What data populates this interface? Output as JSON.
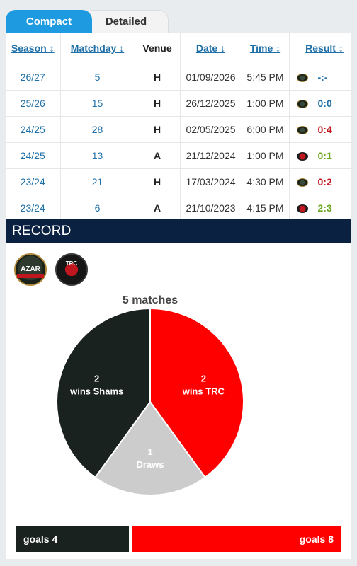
{
  "tabs": {
    "compact": "Compact",
    "detailed": "Detailed"
  },
  "table": {
    "headers": {
      "season": "Season ↕",
      "matchday": "Matchday ↕",
      "venue": "Venue",
      "date": "Date ↓",
      "time": "Time ↕",
      "result": "Result ↕"
    },
    "rows": [
      {
        "season": "26/27",
        "matchday": "5",
        "venue": "H",
        "date": "01/09/2026",
        "time": "5:45 PM",
        "result": "-:-",
        "result_color": "#1e6fa8",
        "logo": "shams"
      },
      {
        "season": "25/26",
        "matchday": "15",
        "venue": "H",
        "date": "26/12/2025",
        "time": "1:00 PM",
        "result": "0:0",
        "result_color": "#1e6fa8",
        "logo": "shams"
      },
      {
        "season": "24/25",
        "matchday": "28",
        "venue": "H",
        "date": "02/05/2025",
        "time": "6:00 PM",
        "result": "0:4",
        "result_color": "#c0161d",
        "logo": "shams"
      },
      {
        "season": "24/25",
        "matchday": "13",
        "venue": "A",
        "date": "21/12/2024",
        "time": "1:00 PM",
        "result": "0:1",
        "result_color": "#6aa61e",
        "logo": "trc"
      },
      {
        "season": "23/24",
        "matchday": "21",
        "venue": "H",
        "date": "17/03/2024",
        "time": "4:30 PM",
        "result": "0:2",
        "result_color": "#c0161d",
        "logo": "shams"
      },
      {
        "season": "23/24",
        "matchday": "6",
        "venue": "A",
        "date": "21/10/2023",
        "time": "4:15 PM",
        "result": "2:3",
        "result_color": "#6aa61e",
        "logo": "trc"
      }
    ]
  },
  "record": {
    "title": "RECORD",
    "logos": {
      "home_text": "AZAR",
      "away_text": "TRC"
    },
    "matches_label": "5 matches",
    "pie": [
      {
        "count": "2",
        "label": "wins Shams",
        "value": 2,
        "color": "#1a221f"
      },
      {
        "count": "2",
        "label": "wins TRC",
        "value": 2,
        "color": "#ff0000"
      },
      {
        "count": "1",
        "label": "Draws",
        "value": 1,
        "color": "#cccccc"
      }
    ],
    "goals_home": "goals 4",
    "goals_away": "goals 8"
  }
}
